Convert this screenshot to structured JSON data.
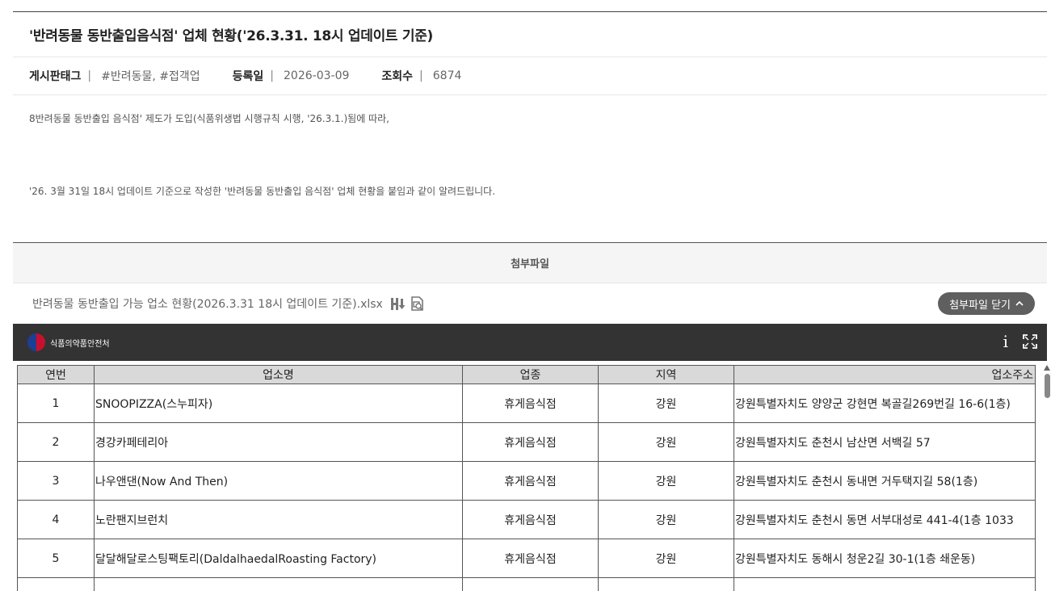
{
  "post": {
    "title": "'반려동물 동반출입음식점' 업체 현황('26.3.31. 18시 업데이트 기준)",
    "meta": {
      "tag_label": "게시판태그",
      "tag_value": "#반려동물, #접객업",
      "date_label": "등록일",
      "date_value": "2026-03-09",
      "views_label": "조회수",
      "views_value": "6874",
      "separator": "|"
    },
    "paragraphs": [
      "8반려동물 동반출입 음식점' 제도가 도입(식품위생법 시행규칙 시행, '26.3.1.)됨에 따라,",
      "'26. 3월 31일 18시 업데이트 기준으로 작성한 '반려동물 동반출입 음식점' 업체 현황을 붙임과 같이 알려드립니다."
    ]
  },
  "attachment": {
    "heading": "첨부파일",
    "file_name": "반려동물 동반출입 가능 업소 현황(2026.3.31 18시 업데이트 기준).xlsx",
    "close_label": "첨부파일 닫기"
  },
  "viewer": {
    "logo_text": "식품의약품안전처",
    "info_glyph": "i"
  },
  "sheet": {
    "headers": [
      "연번",
      "업소명",
      "업종",
      "지역",
      "업소주소"
    ],
    "rows": [
      [
        "1",
        "SNOOPIZZA(스누피자)",
        "휴게음식점",
        "강원",
        "강원특별자치도 양양군 강현면 복골길269번길 16-6(1층)"
      ],
      [
        "2",
        "경강카페테리아",
        "휴게음식점",
        "강원",
        "강원특별자치도 춘천시 남산면 서백길 57"
      ],
      [
        "3",
        "나우앤댄(Now And Then)",
        "휴게음식점",
        "강원",
        "강원특별자치도 춘천시 동내면 거두택지길 58(1층)"
      ],
      [
        "4",
        "노란팬지브런치",
        "휴게음식점",
        "강원",
        "강원특별자치도 춘천시 동면 서부대성로 441-4(1층 1033"
      ],
      [
        "5",
        "달달해달로스팅팩토리(DaldalhaedalRoasting Factory)",
        "휴게음식점",
        "강원",
        "강원특별자치도 동해시 청운2길 30-1(1층 쇄운동)"
      ],
      [
        "",
        "",
        "",
        "",
        ""
      ]
    ]
  }
}
